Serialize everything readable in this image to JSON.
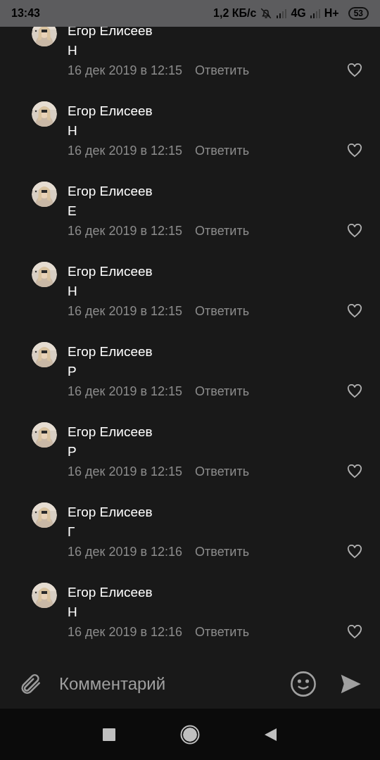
{
  "status_bar": {
    "time": "13:43",
    "speed": "1,2 КБ/с",
    "network_1": "4G",
    "network_2": "H+",
    "battery": "53"
  },
  "comments": [
    {
      "author": "Егор Елисеев",
      "text": "Н",
      "date": "16 дек 2019 в 12:15",
      "reply": "Ответить",
      "liked": false
    },
    {
      "author": "Егор Елисеев",
      "text": "Н",
      "date": "16 дек 2019 в 12:15",
      "reply": "Ответить",
      "liked": false
    },
    {
      "author": "Егор Елисеев",
      "text": "Е",
      "date": "16 дек 2019 в 12:15",
      "reply": "Ответить",
      "liked": false
    },
    {
      "author": "Егор Елисеев",
      "text": "Н",
      "date": "16 дек 2019 в 12:15",
      "reply": "Ответить",
      "liked": false
    },
    {
      "author": "Егор Елисеев",
      "text": "Р",
      "date": "16 дек 2019 в 12:15",
      "reply": "Ответить",
      "liked": false
    },
    {
      "author": "Егор Елисеев",
      "text": "Р",
      "date": "16 дек 2019 в 12:15",
      "reply": "Ответить",
      "liked": false
    },
    {
      "author": "Егор Елисеев",
      "text": "Г",
      "date": "16 дек 2019 в 12:16",
      "reply": "Ответить",
      "liked": false
    },
    {
      "author": "Егор Елисеев",
      "text": "Н",
      "date": "16 дек 2019 в 12:16",
      "reply": "Ответить",
      "liked": false
    }
  ],
  "composer": {
    "placeholder": "Комментарий"
  }
}
